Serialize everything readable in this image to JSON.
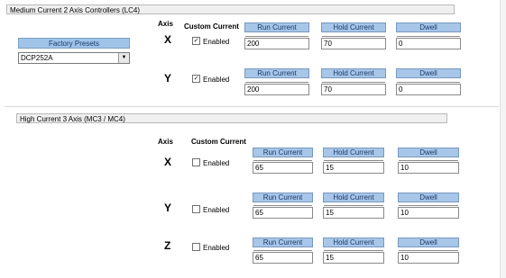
{
  "sections": {
    "medium": {
      "title": "Medium Current 2 Axis Controllers (LC4)"
    },
    "high": {
      "title": "High Current 3 Axis (MC3 / MC4)"
    }
  },
  "presets": {
    "label": "Factory Presets",
    "selected": "DCP252A"
  },
  "columns": {
    "axis": "Axis",
    "custom": "Custom Current",
    "run": "Run Current",
    "hold": "Hold Current",
    "dwell": "Dwell"
  },
  "enabled_label": "Enabled",
  "medium_rows": [
    {
      "axis": "X",
      "enabled": true,
      "check": "✓",
      "run": "200",
      "hold": "70",
      "dwell": "0"
    },
    {
      "axis": "Y",
      "enabled": true,
      "check": "✓",
      "run": "200",
      "hold": "70",
      "dwell": "0"
    }
  ],
  "high_rows": [
    {
      "axis": "X",
      "enabled": false,
      "check": "",
      "run": "65",
      "hold": "15",
      "dwell": "10"
    },
    {
      "axis": "Y",
      "enabled": false,
      "check": "",
      "run": "65",
      "hold": "15",
      "dwell": "10"
    },
    {
      "axis": "Z",
      "enabled": false,
      "check": "",
      "run": "65",
      "hold": "15",
      "dwell": "10"
    }
  ]
}
